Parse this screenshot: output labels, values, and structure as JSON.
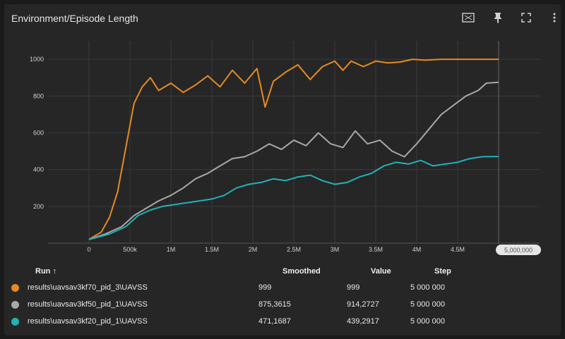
{
  "header": {
    "title": "Environment/Episode Length",
    "icons": [
      "fullscreen-icon",
      "pin-icon",
      "fit-domain-icon",
      "more-vert-icon"
    ]
  },
  "colors": {
    "background": "#262626",
    "grid": "#3a3a3a",
    "series": [
      "#e58a23",
      "#a8a8a8",
      "#1fb3b8"
    ]
  },
  "chart_data": {
    "type": "line",
    "title": "Environment/Episode Length",
    "xlim": [
      -500000,
      5500000
    ],
    "ylim": [
      0,
      1100
    ],
    "x_ticks": [
      0,
      500000,
      1000000,
      1500000,
      2000000,
      2500000,
      3000000,
      3500000,
      4000000,
      4500000
    ],
    "x_tick_labels": [
      "0",
      "500k",
      "1M",
      "1.5M",
      "2M",
      "2.5M",
      "3M",
      "3.5M",
      "4M",
      "4.5M"
    ],
    "y_ticks": [
      200,
      400,
      600,
      800,
      1000
    ],
    "y_tick_labels": [
      "200",
      "400",
      "600",
      "800",
      "1000"
    ],
    "grid": true,
    "series": [
      {
        "name": "results\\uavsav3kf70_pid_3\\UAVSS",
        "color": "#e58a23",
        "x": [
          0,
          150000,
          250000,
          350000,
          450000,
          550000,
          650000,
          750000,
          850000,
          1000000,
          1150000,
          1300000,
          1450000,
          1600000,
          1750000,
          1900000,
          2050000,
          2150000,
          2250000,
          2400000,
          2550000,
          2700000,
          2850000,
          3000000,
          3100000,
          3200000,
          3350000,
          3500000,
          3650000,
          3800000,
          3950000,
          4100000,
          4300000,
          4500000,
          4700000,
          4850000,
          5000000
        ],
        "y": [
          20,
          60,
          140,
          280,
          520,
          760,
          850,
          900,
          830,
          870,
          820,
          860,
          910,
          850,
          940,
          870,
          950,
          740,
          880,
          930,
          970,
          890,
          960,
          990,
          940,
          990,
          960,
          990,
          980,
          985,
          1000,
          995,
          1000,
          1000,
          1000,
          1000,
          1000
        ]
      },
      {
        "name": "results\\uavsav3kf50_pid_1\\UAVSS",
        "color": "#a8a8a8",
        "x": [
          0,
          200000,
          400000,
          550000,
          700000,
          850000,
          1000000,
          1150000,
          1300000,
          1450000,
          1600000,
          1750000,
          1900000,
          2050000,
          2200000,
          2350000,
          2500000,
          2650000,
          2800000,
          2950000,
          3100000,
          3250000,
          3400000,
          3550000,
          3700000,
          3850000,
          4000000,
          4150000,
          4300000,
          4450000,
          4600000,
          4750000,
          4850000,
          5000000
        ],
        "y": [
          20,
          50,
          90,
          150,
          190,
          230,
          260,
          300,
          350,
          380,
          420,
          460,
          470,
          500,
          540,
          510,
          560,
          530,
          600,
          540,
          520,
          610,
          540,
          560,
          500,
          470,
          540,
          620,
          700,
          750,
          800,
          830,
          870,
          875
        ]
      },
      {
        "name": "results\\uavsav3kf20_pid_1\\UAVSS",
        "color": "#1fb3b8",
        "x": [
          0,
          250000,
          450000,
          600000,
          750000,
          900000,
          1050000,
          1200000,
          1350000,
          1500000,
          1650000,
          1800000,
          1950000,
          2100000,
          2250000,
          2400000,
          2550000,
          2700000,
          2850000,
          3000000,
          3150000,
          3300000,
          3450000,
          3600000,
          3750000,
          3900000,
          4050000,
          4200000,
          4350000,
          4500000,
          4650000,
          4800000,
          5000000
        ],
        "y": [
          20,
          50,
          90,
          150,
          180,
          200,
          210,
          220,
          230,
          240,
          260,
          300,
          320,
          330,
          350,
          340,
          360,
          370,
          340,
          320,
          330,
          360,
          380,
          420,
          440,
          430,
          450,
          420,
          430,
          440,
          460,
          470,
          471
        ]
      }
    ]
  },
  "range_pill": {
    "label": "5,000,000"
  },
  "legend": {
    "headers": {
      "run": "Run ↑",
      "smoothed": "Smoothed",
      "value": "Value",
      "step": "Step"
    },
    "rows": [
      {
        "run": "results\\uavsav3kf70_pid_3\\UAVSS",
        "smoothed": "999",
        "value": "999",
        "step": "5 000 000",
        "color": "#e58a23"
      },
      {
        "run": "results\\uavsav3kf50_pid_1\\UAVSS",
        "smoothed": "875,3615",
        "value": "914,2727",
        "step": "5 000 000",
        "color": "#a8a8a8"
      },
      {
        "run": "results\\uavsav3kf20_pid_1\\UAVSS",
        "smoothed": "471,1687",
        "value": "439,2917",
        "step": "5 000 000",
        "color": "#1fb3b8"
      }
    ]
  }
}
